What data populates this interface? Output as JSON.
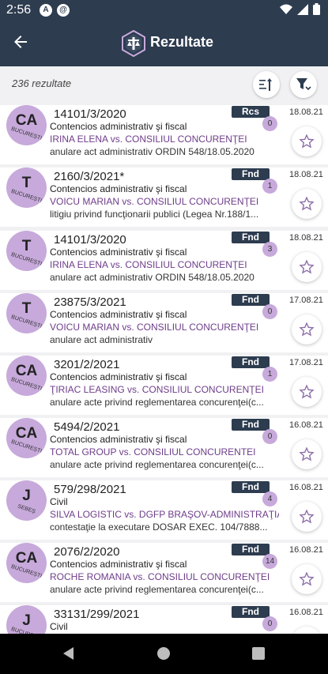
{
  "status": {
    "time": "2:56",
    "icon1": "A",
    "icon2": "@"
  },
  "header": {
    "title": "Rezultate",
    "back_icon": "arrow-left-icon",
    "logo_icon": "scales-logo-icon"
  },
  "subbar": {
    "count": "236 rezultate"
  },
  "colors": {
    "primary": "#2d3c4f",
    "avatar": "#c7a9db",
    "parties": "#6e3d8a"
  },
  "results": [
    {
      "initials": "CA",
      "city": "BUCUREȘTI",
      "number": "14101/3/2020",
      "type": "Contencios administrativ şi fiscal",
      "parties": "IRINA ELENA vs. CONSILIUL CONCURENŢEI",
      "subject": "anulare act administrativ ORDIN 548/18.05.2020",
      "badge": "Rcs",
      "count": "0",
      "date": "18.08.21"
    },
    {
      "initials": "T",
      "city": "BUCUREȘTI",
      "number": "2160/3/2021*",
      "type": "Contencios administrativ şi fiscal",
      "parties": "VOICU MARIAN vs. CONSILIUL CONCURENŢEI",
      "subject": "litigiu privind funcţionarii publici (Legea Nr.188/1...",
      "badge": "Fnd",
      "count": "1",
      "date": "18.08.21"
    },
    {
      "initials": "T",
      "city": "BUCUREȘTI",
      "number": "14101/3/2020",
      "type": "Contencios administrativ şi fiscal",
      "parties": "IRINA ELENA vs. CONSILIUL CONCURENŢEI",
      "subject": "anulare act administrativ ORDIN 548/18.05.2020",
      "badge": "Fnd",
      "count": "3",
      "date": "18.08.21"
    },
    {
      "initials": "T",
      "city": "BUCUREȘTI",
      "number": "23875/3/2021",
      "type": "Contencios administrativ şi fiscal",
      "parties": "VOICU MARIAN vs. CONSILIUL CONCURENŢEI",
      "subject": "anulare act administrativ",
      "badge": "Fnd",
      "count": "0",
      "date": "17.08.21"
    },
    {
      "initials": "CA",
      "city": "BUCUREȘTI",
      "number": "3201/2/2021",
      "type": "Contencios administrativ şi fiscal",
      "parties": "ŢIRIAC LEASING vs. CONSILIUL CONCURENŢEI",
      "subject": "anulare acte privind reglementarea concurenţei(c...",
      "badge": "Fnd",
      "count": "1",
      "date": "17.08.21"
    },
    {
      "initials": "CA",
      "city": "BUCUREȘTI",
      "number": "5494/2/2021",
      "type": "Contencios administrativ şi fiscal",
      "parties": "TOTAL GROUP vs. CONSILIUL CONCURENTEI",
      "subject": "anulare acte privind reglementarea concurenţei(c...",
      "badge": "Fnd",
      "count": "0",
      "date": "16.08.21"
    },
    {
      "initials": "J",
      "city": "SEBEȘ",
      "number": "579/298/2021",
      "type": "Civil",
      "parties": "SILVA LOGISTIC vs. DGFP BRAŞOV-ADMINISTRAŢIA",
      "subject": "contestaţie la executare DOSAR EXEC. 104/7888...",
      "badge": "Fnd",
      "count": "4",
      "date": "16.08.21"
    },
    {
      "initials": "CA",
      "city": "BUCUREȘTI",
      "number": "2076/2/2020",
      "type": "Contencios administrativ şi fiscal",
      "parties": "ROCHE ROMANIA vs. CONSILIUL CONCURENŢEI",
      "subject": "anulare acte privind reglementarea concurenţei(c...",
      "badge": "Fnd",
      "count": "14",
      "date": "16.08.21"
    },
    {
      "initials": "J",
      "city": "BUCUREȘTI",
      "number": "33131/299/2021",
      "type": "Civil",
      "parties": "",
      "subject": "",
      "badge": "Fnd",
      "count": "0",
      "date": "16.08.21"
    }
  ]
}
